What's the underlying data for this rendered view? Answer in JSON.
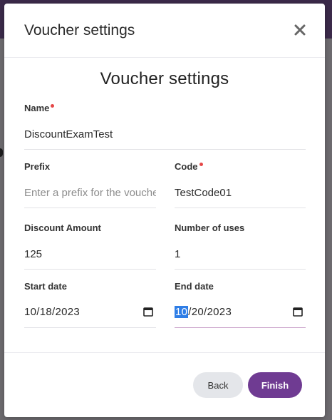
{
  "modal": {
    "title": "Voucher settings",
    "heading": "Voucher settings"
  },
  "fields": {
    "name": {
      "label": "Name",
      "required": true,
      "value": "DiscountExamTest"
    },
    "prefix": {
      "label": "Prefix",
      "required": false,
      "value": "",
      "placeholder": "Enter a prefix for the voucher"
    },
    "code": {
      "label": "Code",
      "required": true,
      "value": "TestCode01"
    },
    "discount_amount": {
      "label": "Discount Amount",
      "value": "125"
    },
    "number_of_uses": {
      "label": "Number of uses",
      "value": "1"
    },
    "start_date": {
      "label": "Start date",
      "value": "10/18/2023"
    },
    "end_date": {
      "label": "End date",
      "month": "10",
      "rest": "/20/2023"
    }
  },
  "buttons": {
    "back": "Back",
    "finish": "Finish"
  },
  "icons": {
    "close": "close-icon",
    "calendar": "calendar-icon"
  },
  "colors": {
    "accent": "#6f3b92",
    "required": "#e54747",
    "selection": "#2f7ee6"
  }
}
